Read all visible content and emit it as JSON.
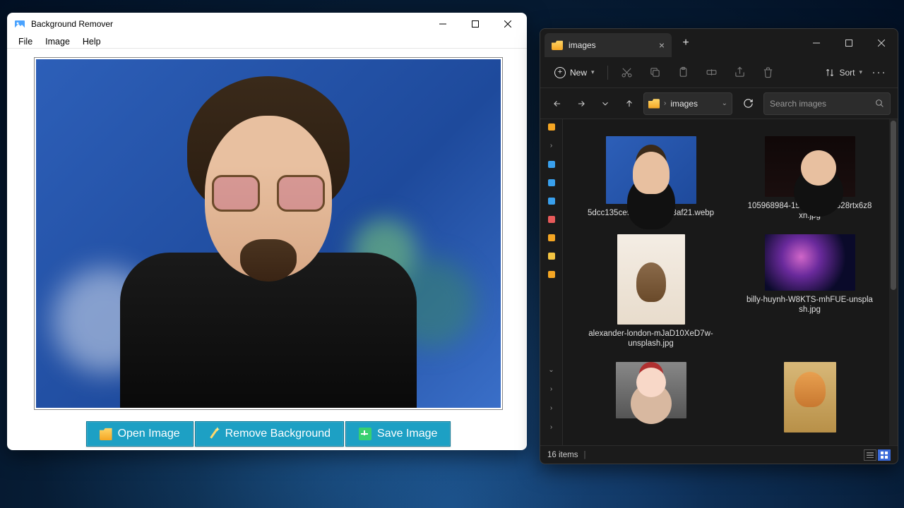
{
  "app": {
    "title": "Background Remover",
    "menus": {
      "file": "File",
      "image": "Image",
      "help": "Help"
    },
    "buttons": {
      "open": "Open Image",
      "remove": "Remove Background",
      "save": "Save Image"
    }
  },
  "explorer": {
    "tab_title": "images",
    "new_label": "New",
    "sort_label": "Sort",
    "breadcrumb": "images",
    "search_placeholder": "Search images",
    "status": "16 items",
    "files": [
      {
        "name": "5dcc135ce94e86714253af21.webp"
      },
      {
        "name": "105968984-1560512308328rtx6z8xn.jpg"
      },
      {
        "name": "alexander-london-mJaD10XeD7w-unsplash.jpg"
      },
      {
        "name": "billy-huynh-W8KTS-mhFUE-unsplash.jpg"
      },
      {
        "name": ""
      },
      {
        "name": ""
      }
    ],
    "sidebar_colors": [
      "#f5a623",
      "#39a0ed",
      "#39a0ed",
      "#39a0ed",
      "#e85a5a",
      "#f5a623",
      "#f5c542",
      "#f5a623"
    ]
  }
}
